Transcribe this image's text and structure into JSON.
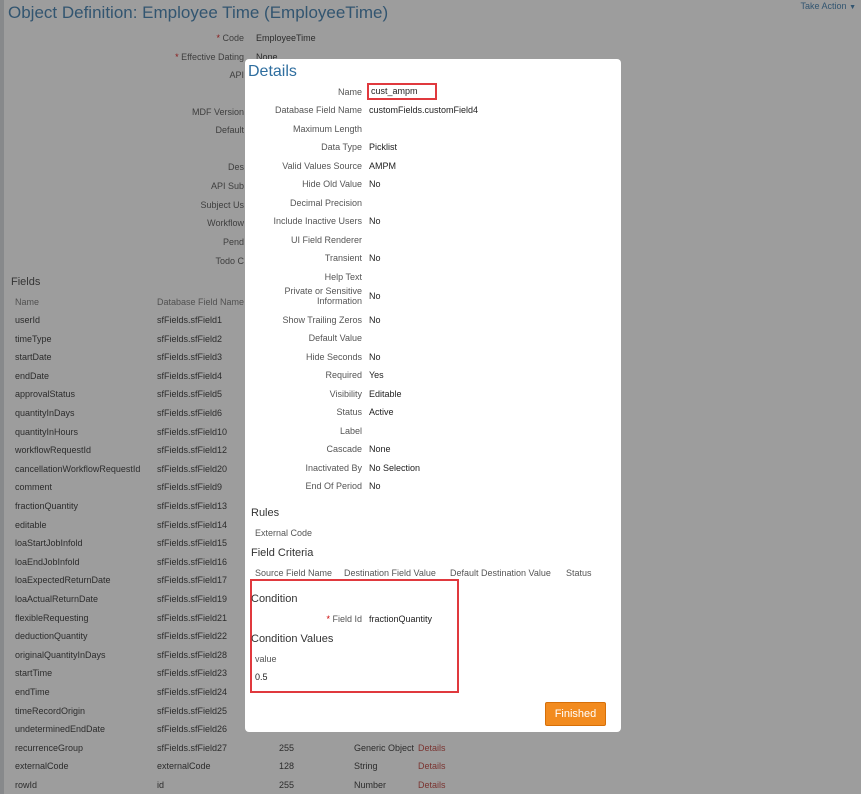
{
  "page": {
    "title": "Object Definition: Employee Time (EmployeeTime)",
    "take_action": "Take Action"
  },
  "background_props": [
    {
      "label": "Code",
      "required": true,
      "value": "EmployeeTime"
    },
    {
      "label": "Effective Dating",
      "required": true,
      "value": "None"
    },
    {
      "label": "API",
      "required": false,
      "value": ""
    },
    {
      "label": "MDF Version",
      "required": false,
      "value": ""
    },
    {
      "label": "Default",
      "required": false,
      "value": ""
    },
    {
      "label": "Des",
      "required": false,
      "value": ""
    },
    {
      "label": "API Sub",
      "required": false,
      "value": ""
    },
    {
      "label": "Subject Us",
      "required": false,
      "value": ""
    },
    {
      "label": "Workflow",
      "required": false,
      "value": ""
    },
    {
      "label": "Pend",
      "required": false,
      "value": ""
    },
    {
      "label": "Todo C",
      "required": false,
      "value": ""
    }
  ],
  "fields": {
    "title": "Fields",
    "headers": [
      "Name",
      "Database Field Name"
    ],
    "rows": [
      {
        "name": "userId",
        "db": "sfFields.sfField1",
        "len": "",
        "type": "",
        "link": ""
      },
      {
        "name": "timeType",
        "db": "sfFields.sfField2",
        "len": "",
        "type": "",
        "link": ""
      },
      {
        "name": "startDate",
        "db": "sfFields.sfField3",
        "len": "",
        "type": "",
        "link": ""
      },
      {
        "name": "endDate",
        "db": "sfFields.sfField4",
        "len": "",
        "type": "",
        "link": ""
      },
      {
        "name": "approvalStatus",
        "db": "sfFields.sfField5",
        "len": "",
        "type": "",
        "link": ""
      },
      {
        "name": "quantityInDays",
        "db": "sfFields.sfField6",
        "len": "",
        "type": "",
        "link": ""
      },
      {
        "name": "quantityInHours",
        "db": "sfFields.sfField10",
        "len": "",
        "type": "",
        "link": ""
      },
      {
        "name": "workflowRequestId",
        "db": "sfFields.sfField12",
        "len": "",
        "type": "",
        "link": ""
      },
      {
        "name": "cancellationWorkflowRequestId",
        "db": "sfFields.sfField20",
        "len": "",
        "type": "",
        "link": ""
      },
      {
        "name": "comment",
        "db": "sfFields.sfField9",
        "len": "",
        "type": "",
        "link": ""
      },
      {
        "name": "fractionQuantity",
        "db": "sfFields.sfField13",
        "len": "",
        "type": "",
        "link": ""
      },
      {
        "name": "editable",
        "db": "sfFields.sfField14",
        "len": "",
        "type": "",
        "link": ""
      },
      {
        "name": "loaStartJobInfold",
        "db": "sfFields.sfField15",
        "len": "",
        "type": "",
        "link": ""
      },
      {
        "name": "loaEndJobInfold",
        "db": "sfFields.sfField16",
        "len": "",
        "type": "",
        "link": ""
      },
      {
        "name": "loaExpectedReturnDate",
        "db": "sfFields.sfField17",
        "len": "",
        "type": "",
        "link": ""
      },
      {
        "name": "loaActualReturnDate",
        "db": "sfFields.sfField19",
        "len": "",
        "type": "",
        "link": ""
      },
      {
        "name": "flexibleRequesting",
        "db": "sfFields.sfField21",
        "len": "",
        "type": "",
        "link": ""
      },
      {
        "name": "deductionQuantity",
        "db": "sfFields.sfField22",
        "len": "",
        "type": "",
        "link": ""
      },
      {
        "name": "originalQuantityInDays",
        "db": "sfFields.sfField28",
        "len": "",
        "type": "",
        "link": ""
      },
      {
        "name": "startTime",
        "db": "sfFields.sfField23",
        "len": "",
        "type": "",
        "link": ""
      },
      {
        "name": "endTime",
        "db": "sfFields.sfField24",
        "len": "",
        "type": "",
        "link": ""
      },
      {
        "name": "timeRecordOrigin",
        "db": "sfFields.sfField25",
        "len": "",
        "type": "",
        "link": ""
      },
      {
        "name": "undeterminedEndDate",
        "db": "sfFields.sfField26",
        "len": "",
        "type": "",
        "link": ""
      },
      {
        "name": "recurrenceGroup",
        "db": "sfFields.sfField27",
        "len": "255",
        "type": "Generic Object",
        "link": "Details"
      },
      {
        "name": "externalCode",
        "db": "externalCode",
        "len": "128",
        "type": "String",
        "link": "Details"
      },
      {
        "name": "rowId",
        "db": "id",
        "len": "255",
        "type": "Number",
        "link": "Details"
      }
    ]
  },
  "modal": {
    "title": "Details",
    "name_label": "Name",
    "name_value": "cust_ampm",
    "props": [
      {
        "label": "Database Field Name",
        "value": "customFields.customField4"
      },
      {
        "label": "Maximum Length",
        "value": ""
      },
      {
        "label": "Data Type",
        "value": "Picklist"
      },
      {
        "label": "Valid Values Source",
        "value": "AMPM"
      },
      {
        "label": "Hide Old Value",
        "value": "No"
      },
      {
        "label": "Decimal Precision",
        "value": ""
      },
      {
        "label": "Include Inactive Users",
        "value": "No"
      },
      {
        "label": "UI Field Renderer",
        "value": ""
      },
      {
        "label": "Transient",
        "value": "No"
      },
      {
        "label": "Help Text",
        "value": ""
      },
      {
        "label": "Private or Sensitive Information",
        "value": "No"
      },
      {
        "label": "Show Trailing Zeros",
        "value": "No"
      },
      {
        "label": "Default Value",
        "value": ""
      },
      {
        "label": "Hide Seconds",
        "value": "No"
      },
      {
        "label": "Required",
        "value": "Yes"
      },
      {
        "label": "Visibility",
        "value": "Editable"
      },
      {
        "label": "Status",
        "value": "Active"
      },
      {
        "label": "Label",
        "value": ""
      },
      {
        "label": "Cascade",
        "value": "None"
      },
      {
        "label": "Inactivated By",
        "value": "No Selection"
      },
      {
        "label": "End Of Period",
        "value": "No"
      }
    ],
    "rules_title": "Rules",
    "rules_col": "External Code",
    "criteria_title": "Field Criteria",
    "criteria_cols": [
      "Source Field Name",
      "Destination Field Value",
      "Default Destination Value",
      "Status"
    ],
    "condition_title": "Condition",
    "field_id_label": "Field Id",
    "field_id_value": "fractionQuantity",
    "condition_values_title": "Condition Values",
    "value_header": "value",
    "value": "0.5",
    "finished_label": "Finished"
  },
  "colors": {
    "accent": "#2f6e9f",
    "highlight": "#e0393e",
    "button": "#f28b1f",
    "link": "#b0302a"
  }
}
